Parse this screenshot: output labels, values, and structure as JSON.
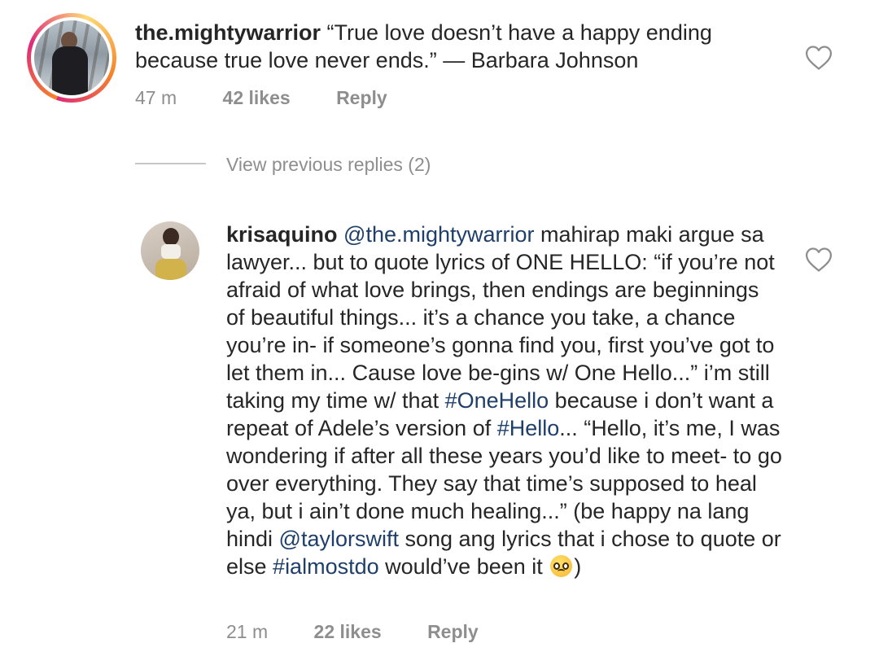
{
  "comments": [
    {
      "username": "the.mightywarrior",
      "text_line1": " “True love doesn’t have a happy ending",
      "text_line2": "because true love never ends.” — Barbara Johnson",
      "time": "47 m",
      "likes": "42 likes",
      "reply": "Reply"
    },
    {
      "username": "krisaquino",
      "mention1": "@the.mightywarrior",
      "seg1": " mahirap maki argue sa lawyer... but to quote lyrics of ONE HELLO: “if you’re not afraid of what love brings, then endings are beginnings of beautiful things... it’s a chance you take, a chance you’re in- if someone’s gonna find you, first you’ve got to let them in... Cause love be-gins w/ One Hello...” i’m still taking my time w/ that ",
      "hashtag1": "#OneHello",
      "seg2": " because i don’t want a repeat of Adele’s version of ",
      "hashtag2": "#Hello",
      "seg3": "... “Hello, it’s me, I was wondering if after all these years you’d like to meet- to go over everything. They say that time’s supposed to heal ya, but i ain’t done much healing...” (be happy na lang hindi ",
      "mention2": "@taylorswift",
      "seg4": " song ang lyrics that i chose to quote or else ",
      "hashtag3": "#ialmostdo",
      "seg5": " would’ve been it ",
      "seg6": ")",
      "emoji": "pleading-face-emoji",
      "time": "21 m",
      "likes": "22 likes",
      "reply": "Reply"
    }
  ],
  "view_previous": "View previous replies (2)",
  "icons": {
    "like": "heart-outline-icon"
  },
  "colors": {
    "link": "#1f3f6b",
    "meta": "#8e8e8e",
    "text": "#262626"
  }
}
